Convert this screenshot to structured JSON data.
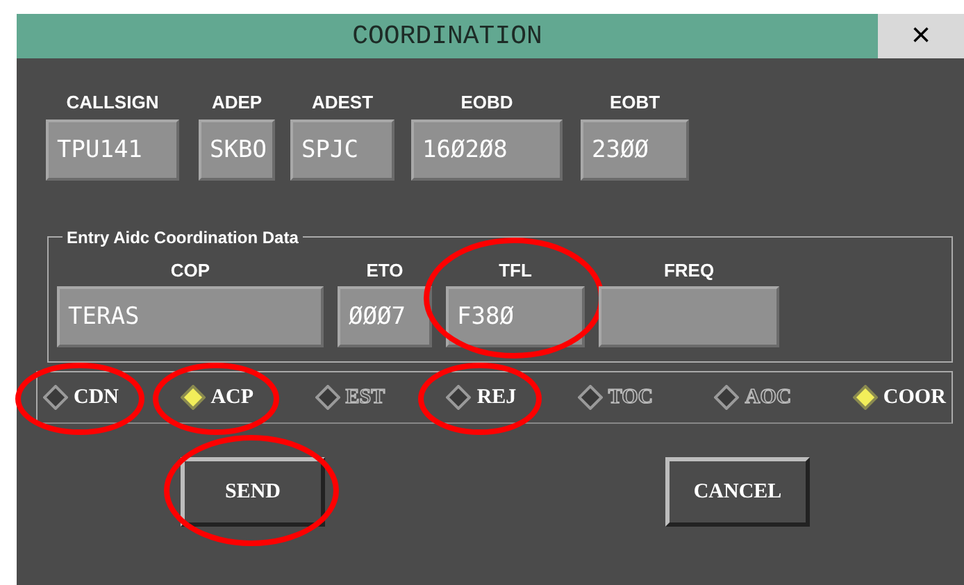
{
  "window": {
    "title": "COORDINATION",
    "close": "×"
  },
  "flight_fields": [
    {
      "label": "CALLSIGN",
      "value": "TPU141",
      "circled": false
    },
    {
      "label": "ADEP",
      "value": "SKBO",
      "circled": false
    },
    {
      "label": "ADEST",
      "value": "SPJC",
      "circled": false
    },
    {
      "label": "EOBD",
      "value": "16Ø2Ø8",
      "circled": false
    },
    {
      "label": "EOBT",
      "value": "23ØØ",
      "circled": false
    }
  ],
  "entry_group": {
    "title": "Entry Aidc Coordination Data",
    "fields": [
      {
        "label": "COP",
        "value": "TERAS",
        "circled": false
      },
      {
        "label": "ETO",
        "value": "ØØØ7",
        "circled": false
      },
      {
        "label": "TFL",
        "value": "F38Ø",
        "circled": true
      },
      {
        "label": "FREQ",
        "circled": false
      }
    ]
  },
  "options": [
    {
      "label": "CDN",
      "selected": false,
      "disabled": false,
      "circled": true
    },
    {
      "label": "ACP",
      "selected": true,
      "disabled": false,
      "circled": true
    },
    {
      "label": "EST",
      "selected": false,
      "disabled": true,
      "circled": false
    },
    {
      "label": "REJ",
      "selected": false,
      "disabled": false,
      "circled": true
    },
    {
      "label": "TOC",
      "selected": false,
      "disabled": true,
      "circled": false
    },
    {
      "label": "AOC",
      "selected": false,
      "disabled": true,
      "circled": false
    },
    {
      "label": "COOR",
      "selected": true,
      "disabled": false,
      "circled": false
    }
  ],
  "buttons": [
    {
      "label": "SEND",
      "circled": true
    },
    {
      "label": "CANCEL",
      "circled": false
    }
  ]
}
